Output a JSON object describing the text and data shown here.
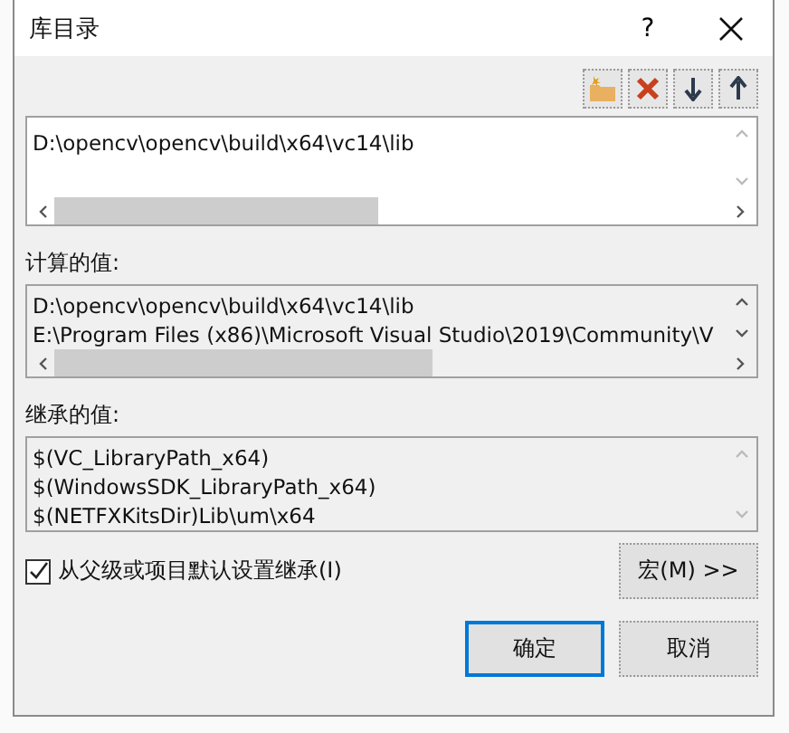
{
  "window": {
    "title": "库目录",
    "help": "?"
  },
  "directories": {
    "lines": [
      "D:\\opencv\\opencv\\build\\x64\\vc14\\lib"
    ]
  },
  "computed": {
    "label": "计算的值:",
    "lines": [
      "D:\\opencv\\opencv\\build\\x64\\vc14\\lib",
      "E:\\Program Files (x86)\\Microsoft Visual Studio\\2019\\Community\\V"
    ]
  },
  "inherited": {
    "label": "继承的值:",
    "lines": [
      "$(VC_LibraryPath_x64)",
      "$(WindowsSDK_LibraryPath_x64)",
      "$(NETFXKitsDir)Lib\\um\\x64"
    ]
  },
  "inherit_option": {
    "label": "从父级或项目默认设置继承(I)",
    "checked": true
  },
  "macro_button": "宏(M) >>",
  "buttons": [
    {
      "label": "确定",
      "selected": true
    },
    {
      "label": "取消",
      "selected": false
    }
  ]
}
